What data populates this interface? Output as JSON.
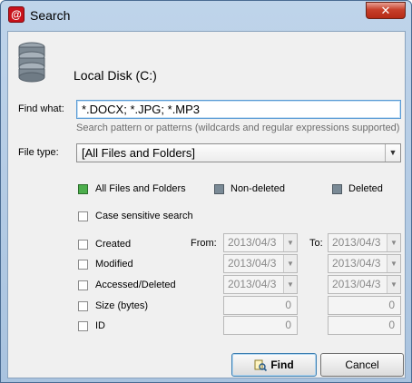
{
  "window": {
    "title": "Search",
    "app_icon": "@",
    "close_glyph": "✕"
  },
  "disk": {
    "icon": "database-disk-icon",
    "label": "Local Disk (C:)"
  },
  "find_what": {
    "label": "Find what:",
    "value": "*.DOCX; *.JPG; *.MP3",
    "hint": "Search pattern or patterns (wildcards and regular expressions supported)"
  },
  "file_type": {
    "label": "File type:",
    "selected": "[All Files and Folders]"
  },
  "filters": {
    "all_files": "All Files and Folders",
    "non_deleted": "Non-deleted",
    "deleted": "Deleted"
  },
  "case_sensitive": "Case sensitive search",
  "criteria": {
    "created": "Created",
    "modified": "Modified",
    "accessed_deleted": "Accessed/Deleted",
    "size": "Size (bytes)",
    "id": "ID",
    "from_label": "From:",
    "to_label": "To:",
    "date_value": "2013/04/3",
    "num_value": "0"
  },
  "buttons": {
    "find": "Find",
    "cancel": "Cancel"
  },
  "colors": {
    "accent_border": "#5a9bd5",
    "green_checkbox": "#4cae4c",
    "close_button": "#c7402b"
  }
}
